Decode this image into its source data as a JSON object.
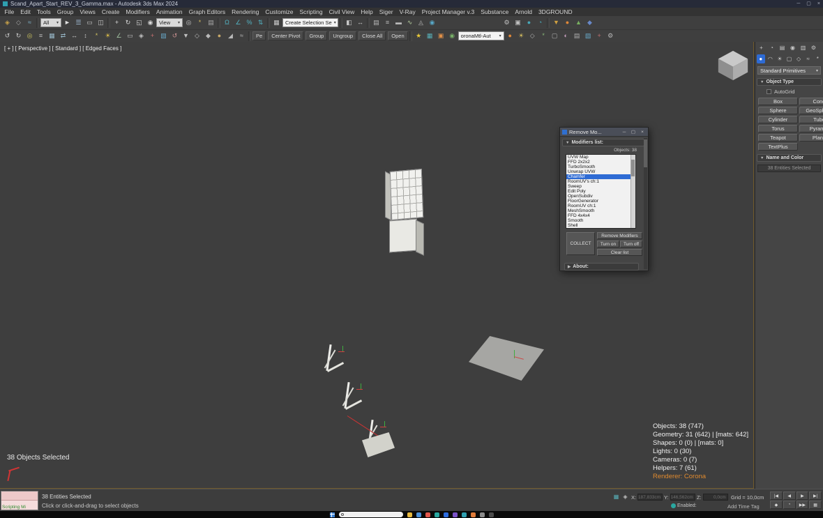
{
  "window": {
    "title": "Scand_Apart_Start_REV_3_Gamma.max - Autodesk 3ds Max 2024",
    "minimize": "─",
    "maximize": "▢",
    "close": "×"
  },
  "menu": {
    "items": [
      "File",
      "Edit",
      "Tools",
      "Group",
      "Views",
      "Create",
      "Modifiers",
      "Animation",
      "Graph Editors",
      "Rendering",
      "Customize",
      "Scripting",
      "Civil View",
      "Help",
      "Siger",
      "V-Ray",
      "Project Manager v.3",
      "Substance",
      "Arnold",
      "3DGROUND"
    ]
  },
  "toolbar1": {
    "filter_dropdown": "All",
    "coord_dropdown": "View",
    "selset_dropdown": "Create Selection Se",
    "g1": [
      {
        "n": "select-and-link-icon",
        "g": "◈",
        "c": "#c8a24a"
      },
      {
        "n": "unlink-selection-icon",
        "g": "◇",
        "c": "#a8a8a8"
      },
      {
        "n": "bind-to-space-warp-icon",
        "g": "≈",
        "c": "#7fb2c8"
      }
    ],
    "g2": [
      {
        "n": "select-object-icon",
        "g": "►",
        "c": "#e0e0e0"
      },
      {
        "n": "select-by-name-icon",
        "g": "☰",
        "c": "#a8c4e0"
      },
      {
        "n": "rectangular-selection-icon",
        "g": "▭",
        "c": "#c8c8c8"
      },
      {
        "n": "window-crossing-icon",
        "g": "◫",
        "c": "#c8c8c8"
      }
    ],
    "g3": [
      {
        "n": "select-and-move-icon",
        "g": "+",
        "c": "#d8d8d8"
      },
      {
        "n": "select-and-rotate-icon",
        "g": "↻",
        "c": "#d8d8d8"
      },
      {
        "n": "select-and-scale-icon",
        "g": "◱",
        "c": "#d8d8d8"
      },
      {
        "n": "select-and-place-icon",
        "g": "◉",
        "c": "#d8d8d8"
      }
    ],
    "g4": [
      {
        "n": "use-pivot-center-icon",
        "g": "◎",
        "c": "#c8c8c8"
      },
      {
        "n": "select-and-manipulate-icon",
        "g": "*",
        "c": "#d0b860"
      },
      {
        "n": "keyboard-override-icon",
        "g": "▤",
        "c": "#a8a8a8"
      }
    ],
    "g5": [
      {
        "n": "snaps-toggle-icon",
        "g": "Ω",
        "c": "#52b2c2"
      },
      {
        "n": "angle-snap-icon",
        "g": "∠",
        "c": "#52b2c2"
      },
      {
        "n": "percent-snap-icon",
        "g": "%",
        "c": "#52b2c2"
      },
      {
        "n": "spinner-snap-icon",
        "g": "⇅",
        "c": "#52b2c2"
      }
    ],
    "g6": [
      {
        "n": "edit-named-selections-icon",
        "g": "▦",
        "c": "#c8c8c8"
      }
    ],
    "g7": [
      {
        "n": "mirror-icon",
        "g": "◧",
        "c": "#c8c8c8"
      },
      {
        "n": "align-icon",
        "g": "↔",
        "c": "#c8c8c8"
      }
    ],
    "g8": [
      {
        "n": "scene-explorer-icon",
        "g": "▤",
        "c": "#b8b8b8"
      },
      {
        "n": "layer-explorer-icon",
        "g": "≡",
        "c": "#b8b8b8"
      },
      {
        "n": "ribbon-toggle-icon",
        "g": "▬",
        "c": "#b8b8b8"
      },
      {
        "n": "curve-editor-icon",
        "g": "∿",
        "c": "#b8d0a0"
      },
      {
        "n": "schematic-view-icon",
        "g": "◬",
        "c": "#b8b8b8"
      },
      {
        "n": "material-editor-icon",
        "g": "◉",
        "c": "#58a8c8"
      }
    ],
    "g9": [
      {
        "n": "render-setup-icon",
        "g": "⚙",
        "c": "#c0c0c0"
      },
      {
        "n": "rendered-frame-icon",
        "g": "▣",
        "c": "#c0c0c0"
      },
      {
        "n": "render-production-icon",
        "g": "●",
        "c": "#48a8b8"
      },
      {
        "n": "render-iterative-icon",
        "g": "◔",
        "c": "#48a8b8"
      }
    ],
    "g10": [
      {
        "n": "vray-toolbar-icon",
        "g": "▼",
        "c": "#d0a040"
      },
      {
        "n": "corona-toolbar-icon",
        "g": "●",
        "c": "#e08838"
      },
      {
        "n": "forest-pack-icon",
        "g": "▲",
        "c": "#78b060"
      },
      {
        "n": "railclone-icon",
        "g": "◆",
        "c": "#6888c8"
      }
    ]
  },
  "toolbar2": {
    "icons_a": [
      {
        "n": "undo-icon",
        "g": "↺",
        "c": "#c8c8c8"
      },
      {
        "n": "redo-icon",
        "g": "↻",
        "c": "#c8c8c8"
      },
      {
        "n": "isolate-selection-icon",
        "g": "◎",
        "c": "#d0c860"
      },
      {
        "n": "layer-manager-icon",
        "g": "≡",
        "c": "#b8b8b8"
      },
      {
        "n": "array-tool-icon",
        "g": "▦",
        "c": "#98b8c8"
      },
      {
        "n": "spacing-tool-icon",
        "g": "⇄",
        "c": "#98b8c8"
      },
      {
        "n": "align-tool-icon",
        "g": "↔",
        "c": "#c8c8c8"
      },
      {
        "n": "normal-align-icon",
        "g": "↕",
        "c": "#c8c8c8"
      },
      {
        "n": "place-highlight-icon",
        "g": "*",
        "c": "#d0c060"
      },
      {
        "n": "sunlight-icon",
        "g": "☀",
        "c": "#e0c048"
      },
      {
        "n": "measure-tool-icon",
        "g": "∠",
        "c": "#a0c0a0"
      },
      {
        "n": "rename-objects-icon",
        "g": "▭",
        "c": "#c0c0c0"
      },
      {
        "n": "select-similar-icon",
        "g": "◈",
        "c": "#c0c0c0"
      },
      {
        "n": "paint-deform-icon",
        "g": "+",
        "c": "#c87070"
      },
      {
        "n": "uvw-map-icon",
        "g": "▧",
        "c": "#68a8c8"
      },
      {
        "n": "reset-xform-icon",
        "g": "↺",
        "c": "#c89090"
      },
      {
        "n": "collapse-utility-icon",
        "g": "▼",
        "c": "#c0c0c0"
      },
      {
        "n": "detach-icon",
        "g": "◇",
        "c": "#b8b8b8"
      },
      {
        "n": "attach-icon",
        "g": "◆",
        "c": "#b8b8b8"
      },
      {
        "n": "weld-icon",
        "g": "●",
        "c": "#c8a868"
      },
      {
        "n": "chamfer-tool-icon",
        "g": "◢",
        "c": "#b8b8b8"
      },
      {
        "n": "relax-tool-icon",
        "g": "≈",
        "c": "#b8b8b8"
      }
    ],
    "buttons": [
      {
        "n": "pe-button",
        "label": "Pe"
      },
      {
        "n": "center-pivot-button",
        "label": "Center Pivot"
      },
      {
        "n": "group-button",
        "label": "Group"
      },
      {
        "n": "ungroup-button",
        "label": "Ungroup"
      },
      {
        "n": "close-all-button",
        "label": "Close All"
      },
      {
        "n": "open-button",
        "label": "Open"
      }
    ],
    "icons_b": [
      {
        "n": "favorites-star-icon",
        "g": "★",
        "c": "#e8c838"
      },
      {
        "n": "grid-toggle-icon",
        "g": "▦",
        "c": "#58b0b8"
      },
      {
        "n": "render-region-icon",
        "g": "▣",
        "c": "#e09048"
      },
      {
        "n": "material-sphere-icon",
        "g": "◉",
        "c": "#78b068"
      }
    ],
    "material_dropdown": "oronaMtl-Aut",
    "icons_c": [
      {
        "n": "corona-converter-icon",
        "g": "●",
        "c": "#e08838"
      },
      {
        "n": "light-lister-icon",
        "g": "☀",
        "c": "#d8c060"
      },
      {
        "n": "proxy-export-icon",
        "g": "◇",
        "c": "#b0b0b0"
      },
      {
        "n": "scatter-tool-icon",
        "g": "*",
        "c": "#88b878"
      },
      {
        "n": "camera-manager-icon",
        "g": "▢",
        "c": "#b0b0b0"
      },
      {
        "n": "color-correct-icon",
        "g": "◐",
        "c": "#c8a0c0"
      },
      {
        "n": "script-runner-icon",
        "g": "▤",
        "c": "#b0b0b0"
      },
      {
        "n": "uv-tools-icon",
        "g": "▧",
        "c": "#68a8c8"
      },
      {
        "n": "cleanup-tool-icon",
        "g": "+",
        "c": "#c07070"
      },
      {
        "n": "settings-gear-icon",
        "g": "⚙",
        "c": "#b8b8b8"
      }
    ]
  },
  "viewport": {
    "label": "[ + ] [ Perspective ] [ Standard ] [ Edged Faces ]",
    "selected_text": "38 Objects Selected",
    "stats": [
      "Objects: 38 (747)",
      "Geometry: 31 (642)   |  [mats: 642]",
      "Shapes: 0 (0)   |  [mats: 0]",
      "Lights: 0 (30)",
      "Cameras: 0 (7)",
      "Helpers: 7 (61)"
    ],
    "renderer": "Renderer: Corona"
  },
  "dialog": {
    "title": "Remove Mo...",
    "minimize": "─",
    "maximize": "▢",
    "close": "×",
    "modifiers_rollout": "Modifiers list:",
    "objects_count": "Objects: 38",
    "list": [
      {
        "label": "UVW Map"
      },
      {
        "label": "FFD 2x2x2"
      },
      {
        "label": "TurboSmooth"
      },
      {
        "label": "Unwrap UVW"
      },
      {
        "label": "Chamfer",
        "selected": true
      },
      {
        "label": "RoomUV's ch:1"
      },
      {
        "label": "Sweep"
      },
      {
        "label": "Edit Poly"
      },
      {
        "label": "OpenSubdiv"
      },
      {
        "label": "FloorGenerator"
      },
      {
        "label": "RoomUV ch:1"
      },
      {
        "label": "MeshSmooth"
      },
      {
        "label": "FFD 4x4x4"
      },
      {
        "label": "Smooth"
      },
      {
        "label": "Shell"
      }
    ],
    "remove_button": "Remove Modifiers",
    "collect_button": "COLLECT",
    "turn_on_button": "Turn on",
    "turn_off_button": "Turn off",
    "clear_button": "Clear list",
    "about_rollout": "About:"
  },
  "panel": {
    "tabs": [
      {
        "n": "create-tab",
        "g": "+"
      },
      {
        "n": "modify-tab",
        "g": "◔"
      },
      {
        "n": "hierarchy-tab",
        "g": "▤"
      },
      {
        "n": "motion-tab",
        "g": "◉"
      },
      {
        "n": "display-tab",
        "g": "▥"
      },
      {
        "n": "utilities-tab",
        "g": "⚙"
      }
    ],
    "categories": [
      {
        "n": "geometry-category",
        "g": "●",
        "sel": true
      },
      {
        "n": "shapes-category",
        "g": "◠"
      },
      {
        "n": "lights-category",
        "g": "☀"
      },
      {
        "n": "cameras-category",
        "g": "▢"
      },
      {
        "n": "helpers-category",
        "g": "◇"
      },
      {
        "n": "spacewarps-category",
        "g": "≈"
      },
      {
        "n": "systems-category",
        "g": "*"
      }
    ],
    "category_dropdown": "Standard Primitives",
    "object_type_rollout": "Object Type",
    "autogrid_label": "AutoGrid",
    "buttons": [
      "Box",
      "Cone",
      "Sphere",
      "GeoSphere",
      "Cylinder",
      "Tube",
      "Torus",
      "Pyramid",
      "Teapot",
      "Plane",
      "TextPlus"
    ],
    "name_color_rollout": "Name and Color",
    "name_field": "38 Entities Selected"
  },
  "statusbar": {
    "listener_label": "Scripting Mi",
    "prompt_line1": "38 Entities Selected",
    "prompt_line2": "Click or click-and-drag to select objects",
    "x_label": "X:",
    "x_value": "187,833cm",
    "y_label": "Y:",
    "y_value": "146,562cm",
    "z_label": "Z:",
    "z_value": "0,0cm",
    "grid_label": "Grid = 10,0cm",
    "time_tag": "Add Time Tag",
    "enabled_label": "Enabled:",
    "transport": [
      {
        "n": "go-to-start-button",
        "g": "|◀"
      },
      {
        "n": "previous-frame-button",
        "g": "◀"
      },
      {
        "n": "play-button",
        "g": "▶"
      },
      {
        "n": "next-frame-button",
        "g": "▶|"
      },
      {
        "n": "key-mode-button",
        "g": "◆"
      },
      {
        "n": "time-config-button",
        "g": "◔"
      },
      {
        "n": "go-to-end-button",
        "g": "▶▶"
      },
      {
        "n": "mute-button",
        "g": "▦"
      }
    ]
  },
  "taskbar": {
    "apps": [
      {
        "n": "file-explorer-icon",
        "c": "#e8b93e"
      },
      {
        "n": "browser-icon",
        "c": "#4a90d9"
      },
      {
        "n": "mail-app-icon",
        "c": "#e2574c"
      },
      {
        "n": "teams-app-icon",
        "c": "#2aa7a0"
      },
      {
        "n": "store-app-icon",
        "c": "#2d6cdf"
      },
      {
        "n": "photos-app-icon",
        "c": "#7a52c7"
      },
      {
        "n": "max-app-icon",
        "c": "#2f9fb0"
      },
      {
        "n": "app-icon-orange",
        "c": "#e07b39"
      },
      {
        "n": "app-icon-gray",
        "c": "#8a8a8a"
      },
      {
        "n": "app-icon-dark",
        "c": "#4a4a4a"
      }
    ]
  }
}
